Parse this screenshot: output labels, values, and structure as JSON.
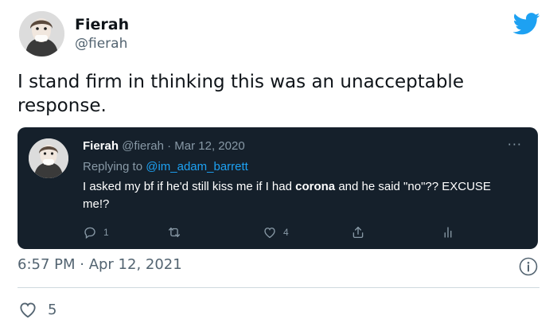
{
  "author": {
    "display_name": "Fierah",
    "handle": "@fierah",
    "avatar_icon": "profile-photo-avatar"
  },
  "brand": {
    "icon": "twitter-bird-icon",
    "color": "#1da1f2"
  },
  "tweet": {
    "text": "I stand firm in thinking this was an unacceptable response.",
    "timestamp": "6:57 PM · Apr 12, 2021",
    "likes": "5"
  },
  "quoted": {
    "display_name": "Fierah",
    "meta": "@fierah · Mar 12, 2020",
    "replying_prefix": "Replying to",
    "replying_to": "@im_adam_barrett",
    "text_part1": "I asked my bf if he'd still kiss me if I had ",
    "text_bold": "corona",
    "text_part2": " and he said \"no\"?? EXCUSE me!?",
    "more": "···",
    "replies": "1",
    "likes": "4",
    "card_color": "#15202b"
  }
}
